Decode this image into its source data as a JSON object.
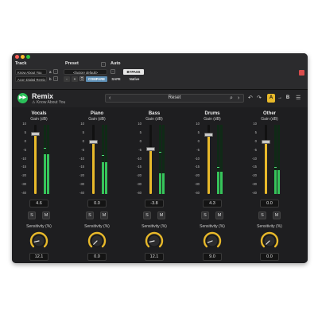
{
  "host": {
    "track_label": "Track",
    "preset_label": "Preset",
    "auto_label": "Auto",
    "track_value": "Know About You",
    "track_suffix": "a",
    "insert_value": "Acon Digital Remix",
    "insert_suffix": "b",
    "preset_value": "<factory default>",
    "minus_label": "-",
    "plus_label": "+",
    "compare_label": "COMPARE",
    "safe_label": "SAFE",
    "bypass_label": "BYPASS",
    "native_label": "Native",
    "bypass_color": "#e8e8e8",
    "compare_color": "#5d8fb5"
  },
  "plugin": {
    "title": "Remix",
    "subtitle": "Know About You",
    "preset_name": "Reset",
    "ab_a_label": "A",
    "ab_arrow_label": "→",
    "ab_b_label": "B",
    "accent_color": "#e8b92a",
    "logo_color": "#2bc05a"
  },
  "scale_ticks": [
    "10",
    "5",
    "0",
    "-5",
    "-10",
    "-15",
    "-20",
    "-30",
    "-40"
  ],
  "channels": [
    {
      "name": "Vocals",
      "gain_label": "Gain (dB)",
      "gain_value": "4.6",
      "gain_db": 4.6,
      "meter_level": 0.58,
      "meter_peak": 0.66,
      "solo_label": "S",
      "mute_label": "M",
      "sens_label": "Sensitivity (%)",
      "sens_value": "12.1",
      "sens_pct": 12.1
    },
    {
      "name": "Piano",
      "gain_label": "Gain (dB)",
      "gain_value": "0.0",
      "gain_db": 0.0,
      "meter_level": 0.46,
      "meter_peak": 0.55,
      "solo_label": "S",
      "mute_label": "M",
      "sens_label": "Sensitivity (%)",
      "sens_value": "0.0",
      "sens_pct": 0.0
    },
    {
      "name": "Bass",
      "gain_label": "Gain (dB)",
      "gain_value": "-3.8",
      "gain_db": -3.8,
      "meter_level": 0.3,
      "meter_peak": 0.6,
      "solo_label": "S",
      "mute_label": "M",
      "sens_label": "Sensitivity (%)",
      "sens_value": "12.1",
      "sens_pct": 12.1
    },
    {
      "name": "Drums",
      "gain_label": "Gain (dB)",
      "gain_value": "4.3",
      "gain_db": 4.3,
      "meter_level": 0.32,
      "meter_peak": 0.38,
      "solo_label": "S",
      "mute_label": "M",
      "sens_label": "Sensitivity (%)",
      "sens_value": "9.0",
      "sens_pct": 9.0
    },
    {
      "name": "Other",
      "gain_label": "Gain (dB)",
      "gain_value": "0.0",
      "gain_db": 0.0,
      "meter_level": 0.34,
      "meter_peak": 0.38,
      "solo_label": "S",
      "mute_label": "M",
      "sens_label": "Sensitivity (%)",
      "sens_value": "0.0",
      "sens_pct": 0.0
    }
  ]
}
